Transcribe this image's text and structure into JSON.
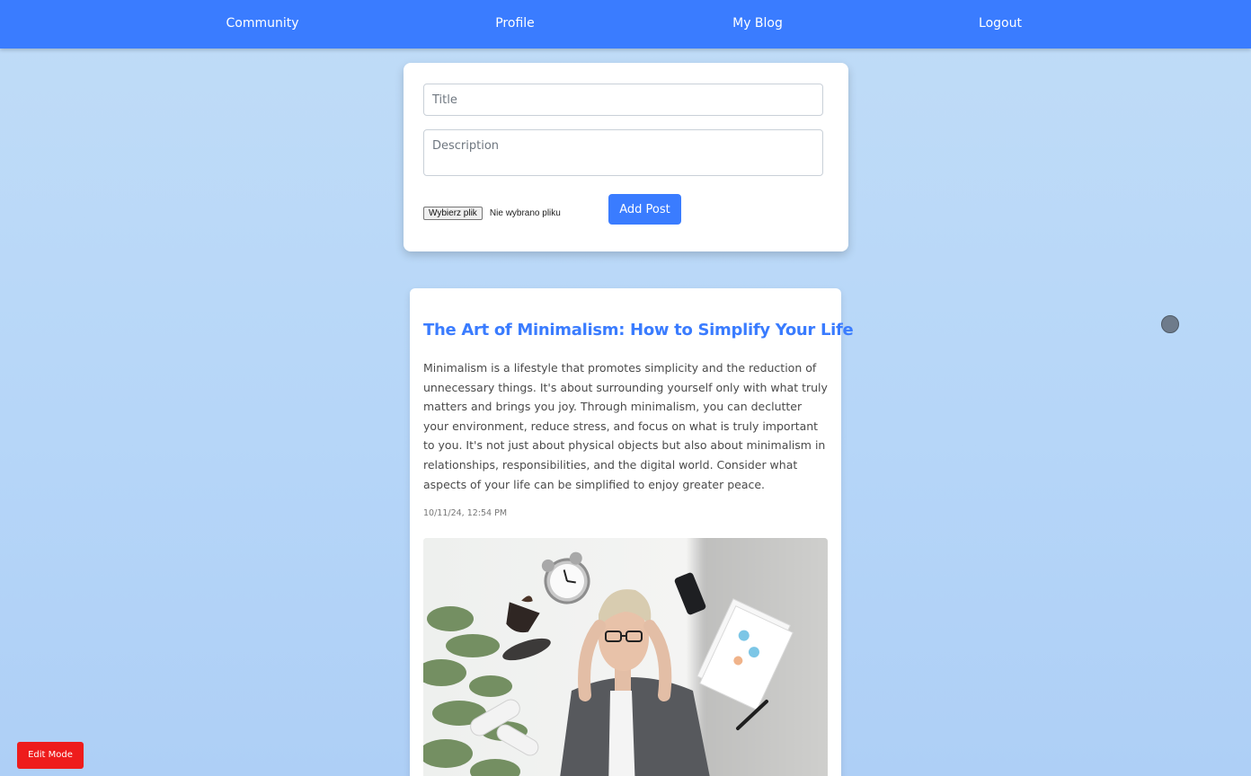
{
  "nav": {
    "items": [
      {
        "label": "Community"
      },
      {
        "label": "Profile"
      },
      {
        "label": "My Blog"
      },
      {
        "label": "Logout"
      }
    ]
  },
  "post_form": {
    "title_placeholder": "Title",
    "description_placeholder": "Description",
    "file_button_label": "Wybierz plik",
    "file_status": "Nie wybrano pliku",
    "submit_label": "Add Post"
  },
  "posts": [
    {
      "title": "The Art of Minimalism: How to Simplify Your Life",
      "body": "Minimalism is a lifestyle that promotes simplicity and the reduction of unnecessary things. It's about surrounding yourself only with what truly matters and brings you joy. Through minimalism, you can declutter your environment, reduce stress, and focus on what is truly important to you. It's not just about physical objects but also about minimalism in relationships, responsibilities, and the digital world. Consider what aspects of your life can be simplified to enjoy greater peace.",
      "date": "10/11/24, 12:54 PM",
      "image_alt": "Stressed woman surrounded by floating alarm clock, phone, coffee cup and papers"
    }
  ],
  "edit_mode": {
    "label": "Edit Mode",
    "color": "#ee1c1c"
  },
  "colors": {
    "accent": "#3a7cff",
    "background": "#bcdaf7"
  }
}
